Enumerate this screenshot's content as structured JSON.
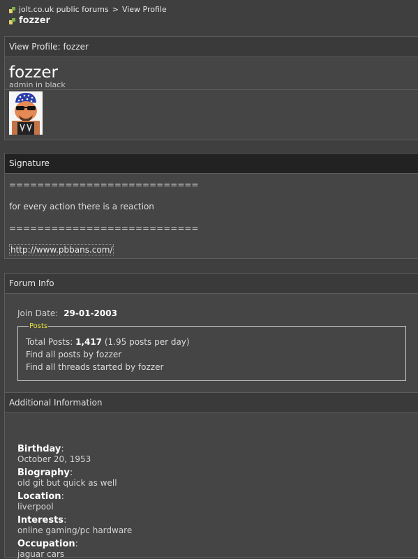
{
  "breadcrumb": {
    "forum_link": "jolt.co.uk public forums",
    "separator": ">",
    "page_link": "View Profile",
    "current": "fozzer"
  },
  "profile_panel": {
    "header": "View Profile: fozzer",
    "username": "fozzer",
    "user_title": "admin in black"
  },
  "signature_panel": {
    "header": "Signature",
    "line1": "===========================",
    "line2": "for every action there is a reaction",
    "line3": "===========================",
    "link": "http://www.pbbans.com/"
  },
  "forum_info": {
    "header": "Forum Info",
    "join_label": "Join Date:",
    "join_value": "29-01-2003",
    "posts_legend": "Posts",
    "total_label": "Total Posts:",
    "total_value": "1,417",
    "per_day": "(1.95 posts per day)",
    "find_posts": "Find all posts by fozzer",
    "find_threads": "Find all threads started by fozzer"
  },
  "additional_info": {
    "header": "Additional Information",
    "fields": [
      {
        "term": "Birthday",
        "value": "October 20, 1953"
      },
      {
        "term": "Biography",
        "value": "old git but quick as well"
      },
      {
        "term": "Location",
        "value": "liverpool"
      },
      {
        "term": "Interests",
        "value": "online gaming/pc hardware"
      },
      {
        "term": "Occupation",
        "value": "jaguar cars"
      }
    ]
  },
  "colors": {
    "page_bg": "#3f3f3f",
    "panel_bg": "#454545",
    "header_dark": "#222222",
    "legend": "#e6e040"
  }
}
